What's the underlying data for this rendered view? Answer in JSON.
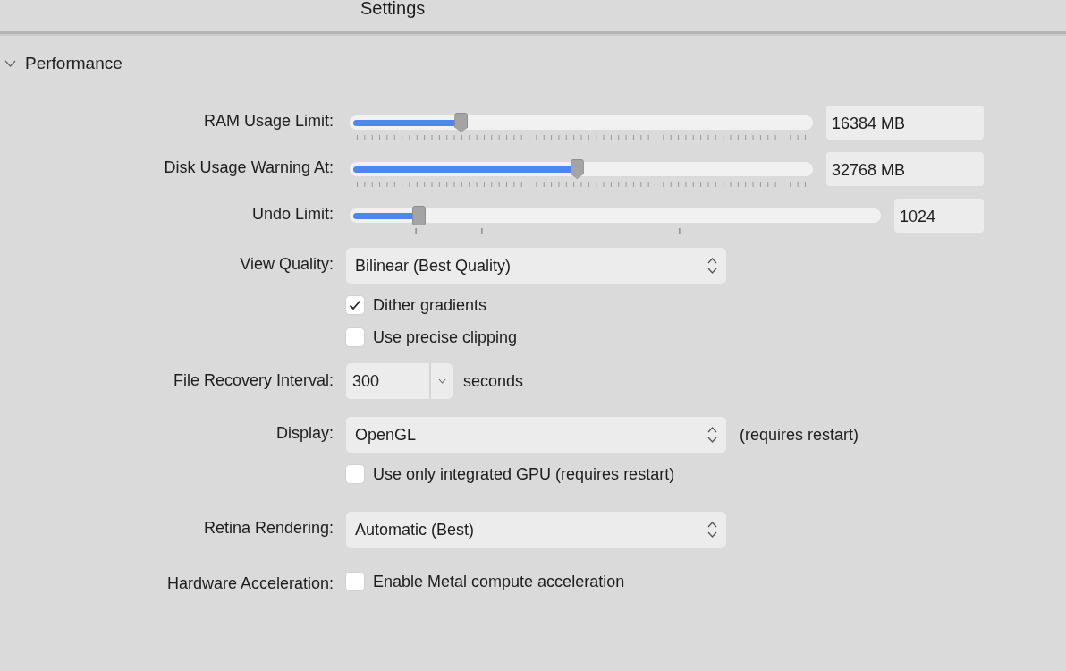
{
  "window": {
    "title": "Settings"
  },
  "section": {
    "title": "Performance",
    "expanded": true
  },
  "rows": [
    {
      "kind": "scale",
      "label": "RAM Usage Limit:",
      "level": 0.24,
      "value": "16384 MB"
    },
    {
      "kind": "scale",
      "label": "Disk Usage Warning At:",
      "level": 0.49,
      "value": "32768 MB"
    },
    {
      "kind": "slider",
      "label": "Undo Limit:",
      "level": 0.13,
      "value": "1024"
    },
    {
      "kind": "select",
      "label": "View Quality:",
      "value": "Bilinear (Best Quality)"
    },
    {
      "kind": "checkbox",
      "text": "Dither gradients",
      "checked": true
    },
    {
      "kind": "checkbox",
      "text": "Use precise clipping",
      "checked": false
    },
    {
      "kind": "combo",
      "label": "File Recovery Interval:",
      "value": "300",
      "suffix": "seconds"
    },
    {
      "kind": "select",
      "label": "Display:",
      "value": "OpenGL",
      "note": "(requires restart)"
    },
    {
      "kind": "checkbox",
      "text": "Use only integrated GPU (requires restart)",
      "checked": false
    },
    {
      "kind": "select",
      "label": "Retina Rendering:",
      "value": "Automatic (Best)"
    },
    {
      "kind": "checkbox",
      "label": "Hardware Acceleration:",
      "text": "Enable Metal compute acceleration",
      "checked": false
    }
  ]
}
